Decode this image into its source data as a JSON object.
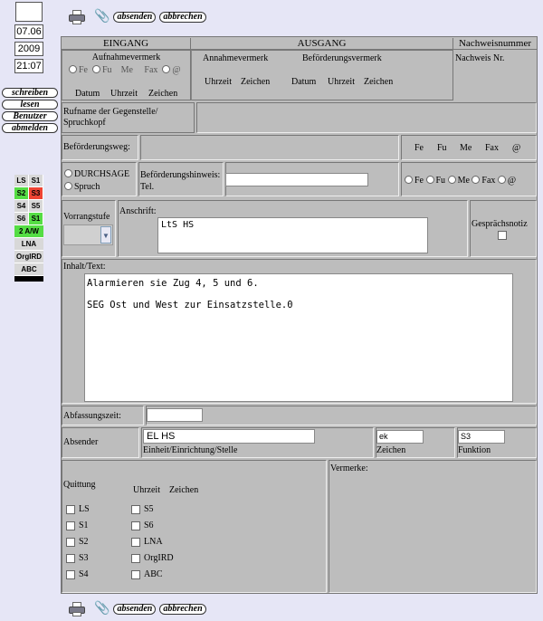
{
  "sidebar": {
    "date": "07.06",
    "year": "2009",
    "time": "21:07",
    "nav": [
      "schreiben",
      "lesen",
      "Benutzer",
      "abmelden"
    ],
    "status": [
      [
        {
          "t": "LS",
          "c": "#d8d8d8"
        },
        {
          "t": "S1",
          "c": "#d8d8d8"
        }
      ],
      [
        {
          "t": "S2",
          "c": "#55dd44"
        },
        {
          "t": "S3",
          "c": "#ee4433"
        }
      ],
      [
        {
          "t": "S4",
          "c": "#d8d8d8"
        },
        {
          "t": "S5",
          "c": "#d8d8d8"
        }
      ],
      [
        {
          "t": "S6",
          "c": "#d8d8d8"
        },
        {
          "t": "S1",
          "c": "#55dd44"
        }
      ],
      [
        {
          "t": "2 A/W",
          "c": "#55dd44"
        }
      ],
      [
        {
          "t": "LNA",
          "c": "#d8d8d8"
        }
      ],
      [
        {
          "t": "OrgIRD",
          "c": "#d8d8d8"
        }
      ],
      [
        {
          "t": "ABC",
          "c": "#d8d8d8"
        }
      ]
    ]
  },
  "toolbar": {
    "send": "absenden",
    "cancel": "abbrechen"
  },
  "form": {
    "eingang": "EINGANG",
    "ausgang": "AUSGANG",
    "nachweisnummer": "Nachweisnummer",
    "aufnahmevermerk": "Aufnahmevermerk",
    "annahmevermerk": "Annahmevermerk",
    "befoerderungsvermerk": "Beförderungsvermerk",
    "nachweis_nr": "Nachweis Nr.",
    "modes_in": [
      "Fe",
      "Fu",
      "Me",
      "Fax",
      "@"
    ],
    "datum": "Datum",
    "uhrzeit": "Uhrzeit",
    "zeichen": "Zeichen",
    "rufname": "Rufname der Gegenstelle/ Spruchkopf",
    "befoerderungsweg": "Beförderungsweg:",
    "modes_weg": [
      "Fe",
      "Fu",
      "Me",
      "Fax",
      "@"
    ],
    "durchsage": "DURCHSAGE",
    "spruch": "Spruch",
    "befoerderungshinweis": "Beförderungshinweis:",
    "tel": "Tel.",
    "modes_radio": [
      "Fe",
      "Fu",
      "Me",
      "Fax",
      "@"
    ],
    "vorrangstufe": "Vorrangstufe",
    "anschrift": "Anschrift:",
    "anschrift_value": "LtS HS",
    "gespraechsnotiz": "Gesprächsnotiz",
    "inhalt": "Inhalt/Text:",
    "inhalt_line1": "Alarmieren sie Zug 4, 5 und 6.",
    "inhalt_line2": "SEG Ost und West zur Einsatzstelle.0",
    "abfassungszeit": "Abfassungszeit:",
    "absender": "Absender",
    "absender_value": "EL HS",
    "einheit": "Einheit/Einrichtung/Stelle",
    "zeichen_value": "ek",
    "funktion": "Funktion",
    "funktion_value": "S3",
    "quittung": "Quittung",
    "vermerke": "Vermerke:",
    "quittung_left": [
      "LS",
      "S1",
      "S2",
      "S3",
      "S4"
    ],
    "quittung_right": [
      "S5",
      "S6",
      "LNA",
      "OrgIRD",
      "ABC"
    ]
  }
}
